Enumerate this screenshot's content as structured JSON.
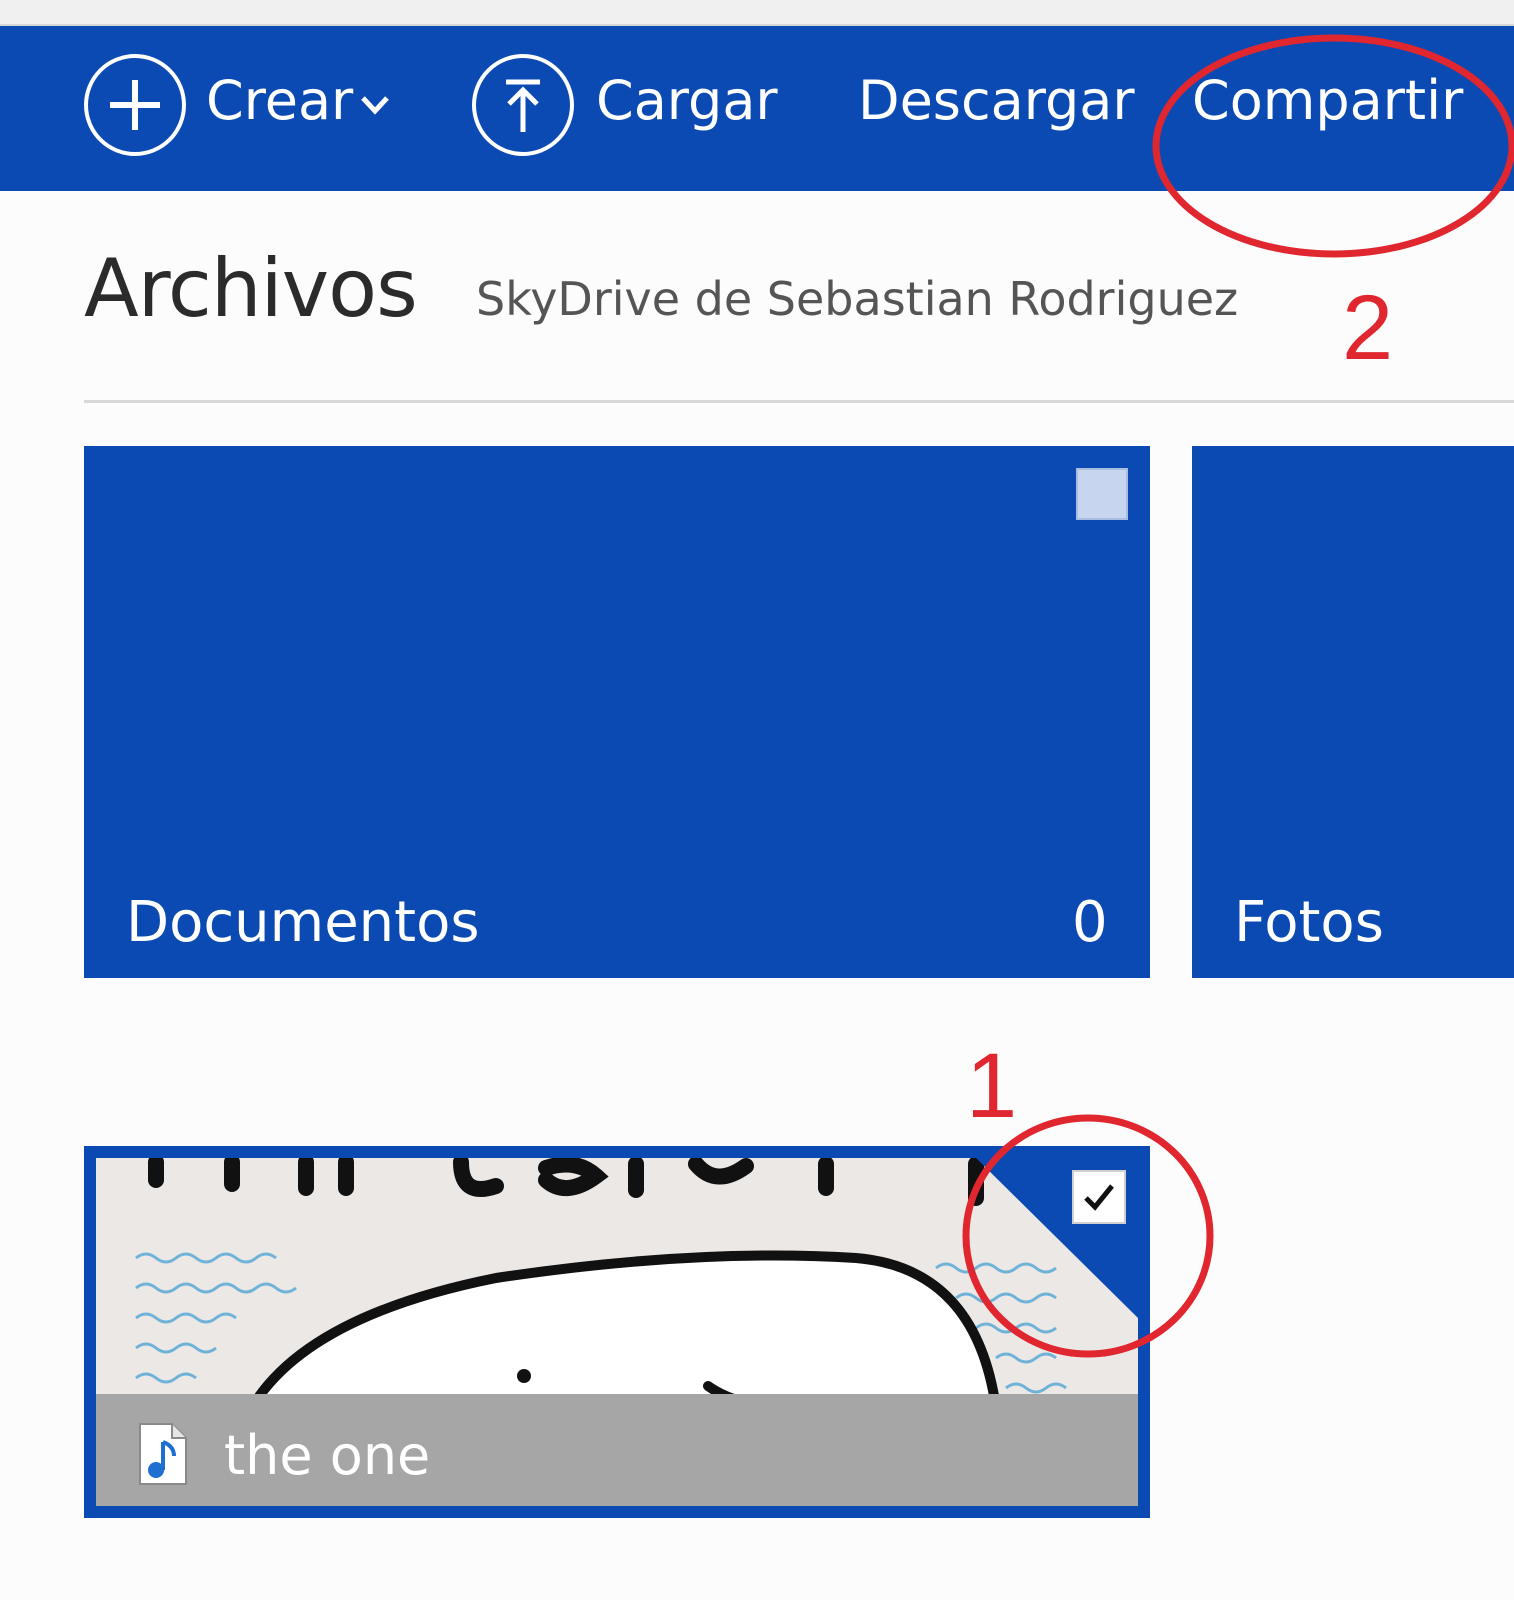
{
  "toolbar": {
    "create_label": "Crear",
    "upload_label": "Cargar",
    "download_label": "Descargar",
    "share_label": "Compartir",
    "icons": [
      "plus-circle-icon",
      "chevron-down-icon",
      "upload-circle-icon"
    ],
    "background_color": "#0c4ab3"
  },
  "header": {
    "title": "Archivos",
    "owner": "SkyDrive de Sebastian Rodriguez"
  },
  "folders": [
    {
      "name": "Documentos",
      "count": "0",
      "selected": false
    },
    {
      "name": "Fotos",
      "selected": false
    }
  ],
  "files": [
    {
      "name": "the one",
      "type_icon": "music-file-icon",
      "selected": true
    }
  ],
  "annotations": {
    "step1": "1",
    "step2": "2",
    "color": "#e0262e"
  }
}
